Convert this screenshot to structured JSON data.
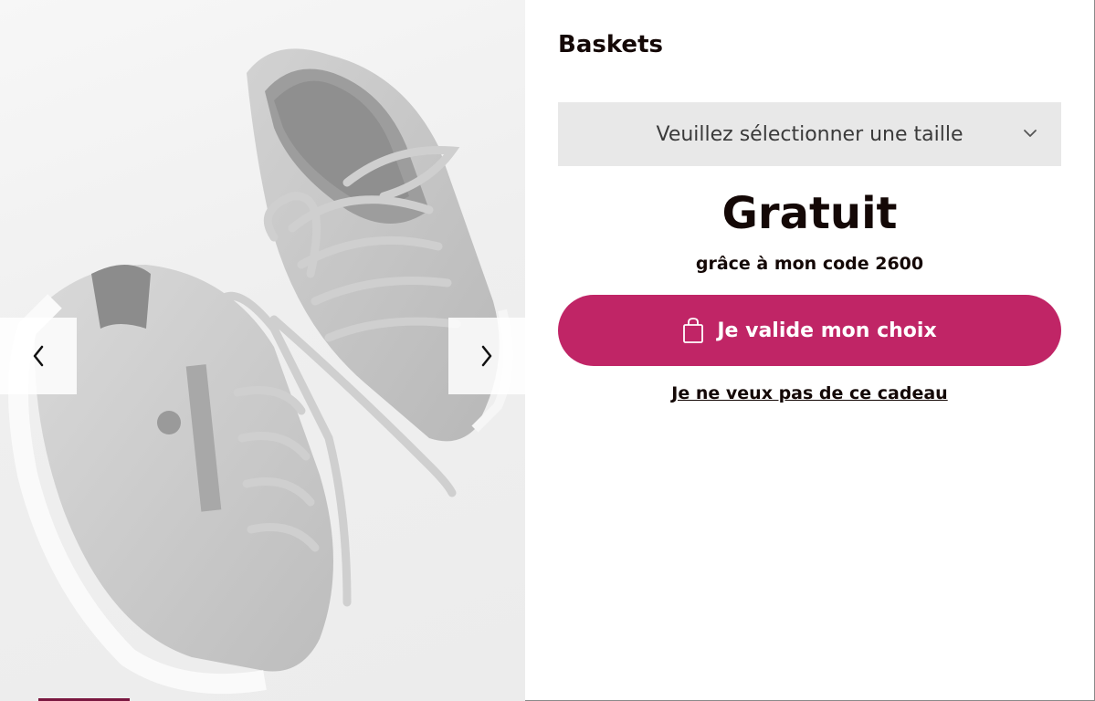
{
  "product": {
    "title": "Baskets"
  },
  "size_select": {
    "placeholder": "Veuillez sélectionner une taille",
    "icon": "chevron-down-icon"
  },
  "price": {
    "label": "Gratuit",
    "subtitle": "grâce à mon code 2600"
  },
  "actions": {
    "confirm_label": "Je valide mon choix",
    "confirm_icon": "shopping-bag-icon",
    "decline_label": "Je ne veux pas de ce cadeau"
  },
  "gallery": {
    "prev_icon": "chevron-left-icon",
    "next_icon": "chevron-right-icon"
  },
  "colors": {
    "accent": "#c02566",
    "text": "#140806",
    "select_bg": "#e8e8e8"
  }
}
